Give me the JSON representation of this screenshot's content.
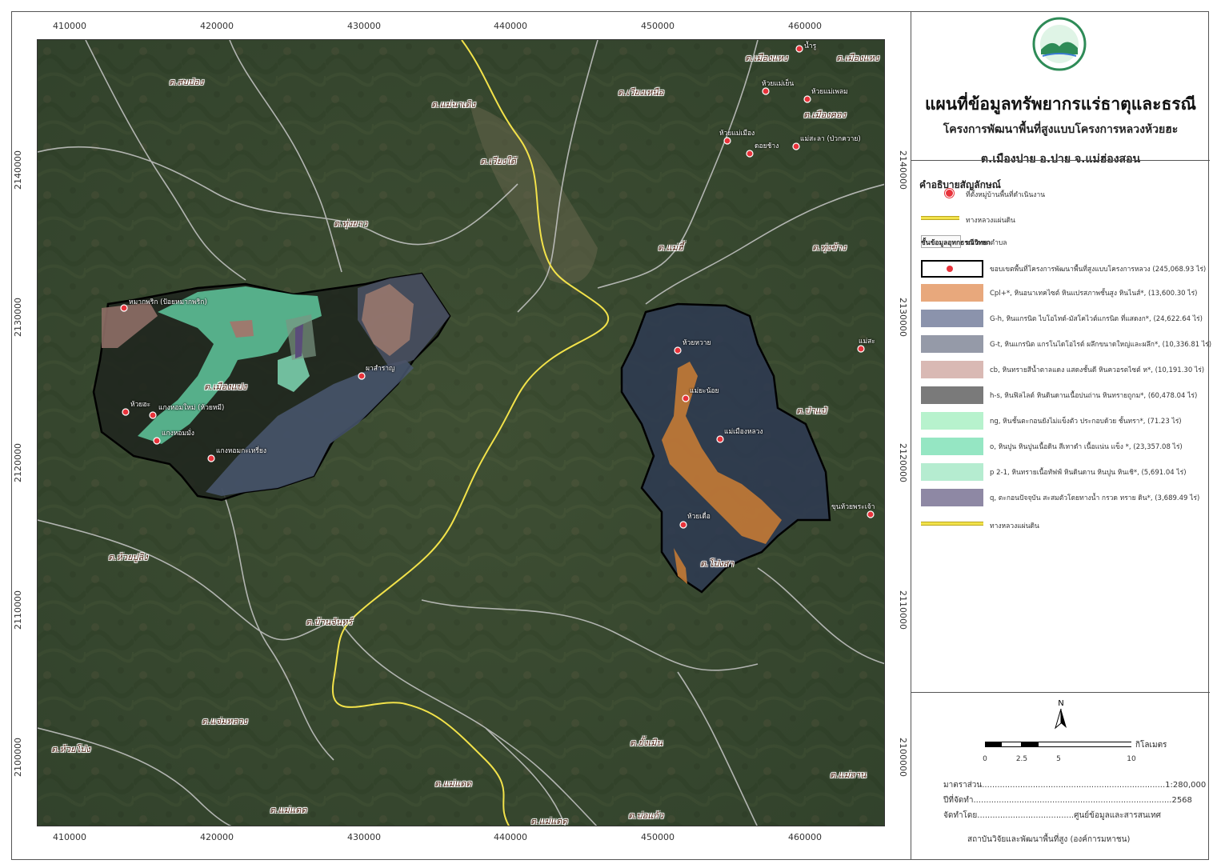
{
  "title": {
    "main": "แผนที่ข้อมูลทรัพยากรแร่ธาตุและธรณี",
    "project": "โครงการพัฒนาพื้นที่สูงแบบโครงการหลวงห้วยฮะ",
    "location": "ต.เมืองปาย อ.ปาย จ.แม่ฮ่องสอน"
  },
  "colors": {
    "background_imagery": "#3a4a32",
    "highway": "#f2e24a",
    "road": "#c8c8c8",
    "boundary": "#000000",
    "marker": "#e8333b"
  },
  "axis": {
    "x_ticks": [
      "410000",
      "420000",
      "430000",
      "440000",
      "450000",
      "460000"
    ],
    "y_ticks": [
      "2140000",
      "2130000",
      "2120000",
      "2110000",
      "2100000"
    ]
  },
  "legend": {
    "title": "คำอธิบายสัญลักษณ์",
    "village_label": "ที่ตั้งหมู่บ้านพื้นที่ดำเนินงาน",
    "highway_label": "ทางหลวงแผ่นดิน",
    "subdistrict_label": "ขอบเขตตำบล",
    "layer_header": "ชั้นข้อมูลอุทกธรณีวิทยา",
    "project_area_label": "ขอบเขตพื้นที่โครงการพัฒนาพื้นที่สูงแบบโครงการหลวง (245,068.93 ไร่)",
    "units": [
      {
        "code": "Cpl+*",
        "desc": "Cpl+*,  หินอนาเทคไซต์ หินแปรสภาพชั้นสูง หินไนส์*, (13,600.30 ไร่)",
        "color": "#e8a87c"
      },
      {
        "code": "G-h",
        "desc": "G-h,  หินแกรนิต ไบโอไทต์-มัสโคไวต์แกรนิต ที่แสดงก*, (24,622.64 ไร่)",
        "color": "#8b93ac"
      },
      {
        "code": "G-t",
        "desc": "G-t,  หินแกรนิต แกรโนไดโอไรต์ ผลึกขนาดใหญ่และผลึก*, (10,336.81 ไร่)",
        "color": "#959aa8"
      },
      {
        "code": "cb",
        "desc": "cb,  หินทรายสีน้ำตาลแดง แสดงชั้นดี หินควอรตไซต์ ห*, (10,191.30 ไร่)",
        "color": "#d9b9b4"
      },
      {
        "code": "h-s",
        "desc": "h-s,  หินฟิลไลต์ หินดินดานเนื้อปนถ่าน หินทรายถูกม*, (60,478.04 ไร่)",
        "color": "#7a7a7a"
      },
      {
        "code": "ng",
        "desc": "ng,  หินชั้นตะกอนยังไม่แข็งตัว ประกอบด้วย ชั้นทรา*, (71.23 ไร่)",
        "color": "#b7f2cd"
      },
      {
        "code": "o",
        "desc": "o,  หินปูน หินปูนเนื้อดิน สีเทาดำ เนื้อแน่น แข็ง *, (23,357.08 ไร่)",
        "color": "#95e6c3"
      },
      {
        "code": "p 2-1",
        "desc": "p 2-1,  หินทรายเนื้อทัฟฟ์ หินดินดาน หินปูน หินเชิ*, (5,691.04 ไร่)",
        "color": "#b5ecd0"
      },
      {
        "code": "q",
        "desc": "q,  ตะกอนปัจจุบัน สะสมตัวโดยทางน้ำ กรวด ทราย ดิน*, (3,689.49 ไร่)",
        "color": "#8e88a4"
      }
    ],
    "highway_label_2": "ทางหลวงแผ่นดิน"
  },
  "scale": {
    "labels": [
      "0",
      "2.5",
      "5",
      "10"
    ],
    "unit": "กิโลเมตร",
    "north": "N"
  },
  "metadata": {
    "scale_label": "มาตราส่วน",
    "scale_value": "1:280,000",
    "year_label": "ปีที่จัดทำ",
    "year_value": "2568",
    "author_label": "จัดทำโดย",
    "author_value": "ศูนย์ข้อมูลและสารสนเทศ",
    "institute": "สถาบันวิจัยและพัฒนาพื้นที่สูง (องค์การมหาชน)"
  },
  "places": [
    {
      "name": "ต.สบป่อง"
    },
    {
      "name": "ต.แม่นาเติง"
    },
    {
      "name": "ต.เวียงเหนือ"
    },
    {
      "name": "ต.เวียงใต้"
    },
    {
      "name": "ต.ทุ่งยาว"
    },
    {
      "name": "ต.แม่ฮี้"
    },
    {
      "name": "ต.ทุ่งข้าง"
    },
    {
      "name": "ต.เมืองแปง"
    },
    {
      "name": "ต.ป่าแป๋"
    },
    {
      "name": "ต.ห้วยปูลิง"
    },
    {
      "name": "ต.บ้านจันทร์"
    },
    {
      "name": "ต.โป่งสา"
    },
    {
      "name": "ต.แจ่มหลวง"
    },
    {
      "name": "ต.ห้วยโป่ง"
    },
    {
      "name": "ต.ยั้งเมิน"
    },
    {
      "name": "ต.แม่แดด"
    },
    {
      "name": "ต.แม่แดด"
    },
    {
      "name": "ต.แม่แดด"
    },
    {
      "name": "ต.บ่อแก้ว"
    },
    {
      "name": "ต.แม่ลาน"
    },
    {
      "name": "ต.เมืองแหง"
    },
    {
      "name": "ต.เมืองแหง"
    },
    {
      "name": "ต.เมืองคอง"
    }
  ],
  "villages": [
    {
      "name": "หมากพริก (ป้อยหมากพริก)"
    },
    {
      "name": "ห้วยฮะ"
    },
    {
      "name": "แกงหอมใหม่ (ห้วยหมี)"
    },
    {
      "name": "แกงหอมมั่ง"
    },
    {
      "name": "แกงหอมกะเหรี่ยง"
    },
    {
      "name": "ผาสำราญ"
    },
    {
      "name": "ห้วยหวาย"
    },
    {
      "name": "แม่ยะน้อย"
    },
    {
      "name": "แม่เมืองหลวง"
    },
    {
      "name": "ห้วยเดื่อ"
    },
    {
      "name": "แม่สะ"
    },
    {
      "name": "ขุนห้วยพระเจ้า"
    },
    {
      "name": "น้ำรู"
    },
    {
      "name": "ห้วยแม่เย็น"
    },
    {
      "name": "ห้วยแม่เพลม"
    },
    {
      "name": "ห้วยแม่เมือง"
    },
    {
      "name": "ดอยช้าง"
    },
    {
      "name": "แม่สะลา (ป่วกควาย)"
    }
  ]
}
